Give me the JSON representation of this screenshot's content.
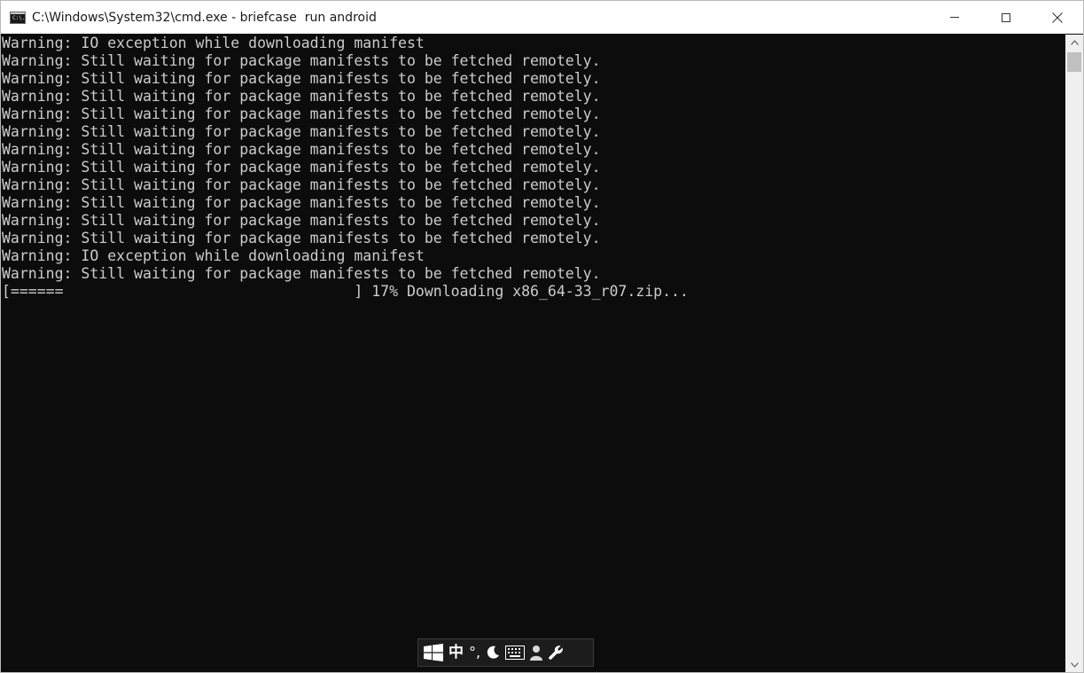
{
  "window": {
    "title": "C:\\Windows\\System32\\cmd.exe - briefcase  run android",
    "icon_text": "C:\\."
  },
  "console": {
    "lines": [
      "Warning: IO exception while downloading manifest",
      "Warning: Still waiting for package manifests to be fetched remotely.",
      "Warning: Still waiting for package manifests to be fetched remotely.",
      "Warning: Still waiting for package manifests to be fetched remotely.",
      "Warning: Still waiting for package manifests to be fetched remotely.",
      "Warning: Still waiting for package manifests to be fetched remotely.",
      "Warning: Still waiting for package manifests to be fetched remotely.",
      "Warning: Still waiting for package manifests to be fetched remotely.",
      "Warning: Still waiting for package manifests to be fetched remotely.",
      "Warning: Still waiting for package manifests to be fetched remotely.",
      "Warning: Still waiting for package manifests to be fetched remotely.",
      "Warning: Still waiting for package manifests to be fetched remotely.",
      "Warning: IO exception while downloading manifest",
      "Warning: Still waiting for package manifests to be fetched remotely."
    ],
    "progress": {
      "bar_text": "[======                                 ]",
      "percent": 17,
      "percent_text": "17%",
      "status": "Downloading x86_64-33_r07.zip..."
    }
  },
  "ime": {
    "mode_label": "中",
    "punct_label": "°,",
    "icons": [
      "windows-logo-icon",
      "moon-icon",
      "keyboard-icon",
      "user-icon",
      "wrench-icon"
    ]
  },
  "colors": {
    "console_bg": "#0c0c0c",
    "console_fg": "#cccccc",
    "titlebar_bg": "#ffffff",
    "scrollbar_bg": "#f0f0f0",
    "ime_bg": "#1c1c1c"
  }
}
